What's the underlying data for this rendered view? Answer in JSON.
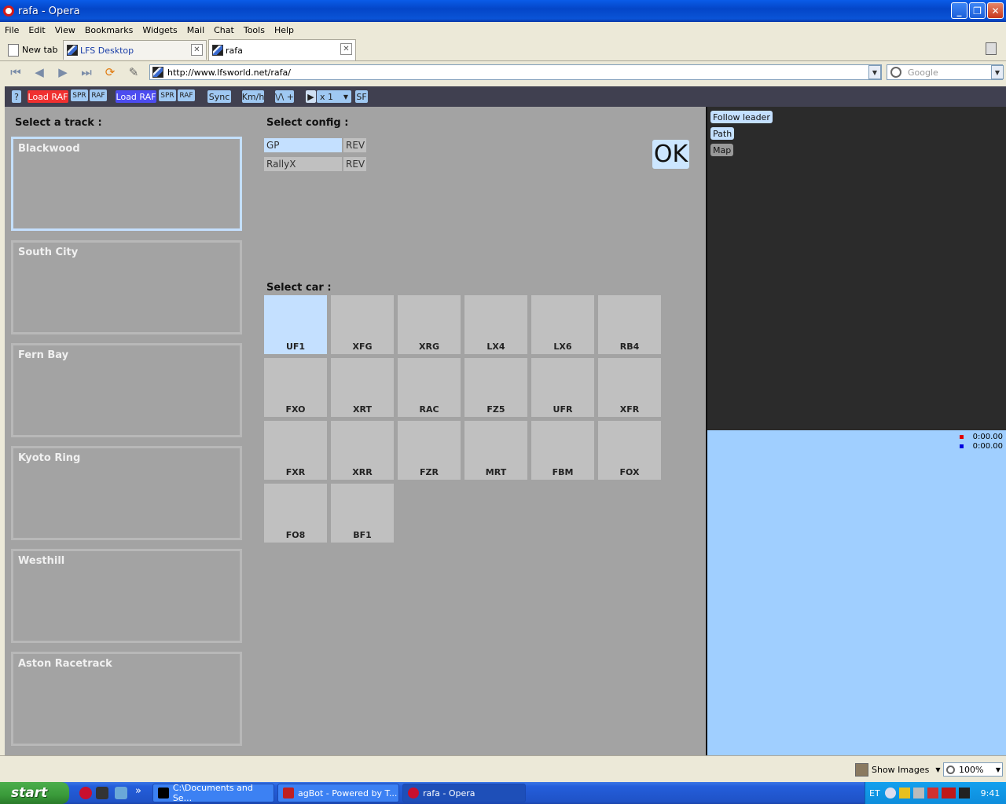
{
  "window": {
    "title": "rafa - Opera"
  },
  "menu": [
    "File",
    "Edit",
    "View",
    "Bookmarks",
    "Widgets",
    "Mail",
    "Chat",
    "Tools",
    "Help"
  ],
  "tabs": {
    "new_tab": "New tab",
    "tab1": "LFS Desktop",
    "tab2": "rafa"
  },
  "address": {
    "url": "http://www.lfsworld.net/rafa/",
    "search_placeholder": "Google"
  },
  "toolbar": {
    "help": "?",
    "load_raf_1": "Load RAF",
    "spr_1": "SPR",
    "raf_1": "RAF",
    "load_raf_2": "Load RAF",
    "spr_2": "SPR",
    "raf_2": "RAF",
    "sync": "Sync",
    "kmh": "Km/h",
    "vplus": "\\/\\ +",
    "speed": "x 1",
    "sf": "SF"
  },
  "labels": {
    "select_track": "Select a track :",
    "select_config": "Select config :",
    "select_car": "Select car :",
    "ok": "OK"
  },
  "tracks": [
    "Blackwood",
    "South City",
    "Fern Bay",
    "Kyoto Ring",
    "Westhill",
    "Aston Racetrack"
  ],
  "configs": [
    {
      "name": "GP",
      "rev": "REV"
    },
    {
      "name": "RallyX",
      "rev": "REV"
    }
  ],
  "cars": [
    "UF1",
    "XFG",
    "XRG",
    "LX4",
    "LX6",
    "RB4",
    "FXO",
    "XRT",
    "RAC",
    "FZ5",
    "UFR",
    "XFR",
    "FXR",
    "XRR",
    "FZR",
    "MRT",
    "FBM",
    "FOX",
    "FO8",
    "BF1"
  ],
  "map_panel": {
    "follow_leader": "Follow leader",
    "path": "Path",
    "map": "Map"
  },
  "times": [
    "0:00.00",
    "0:00.00"
  ],
  "status": {
    "show_images": "Show Images",
    "zoom": "100%"
  },
  "taskbar": {
    "start": "start",
    "tasks": [
      "C:\\Documents and Se...",
      "agBot - Powered by T...",
      "rafa - Opera"
    ],
    "lang": "ET",
    "clock": "9:41"
  },
  "colors": {
    "selected": "#c4e0ff",
    "load_raf_red": "#f03030",
    "load_raf_blue": "#4c4cf0",
    "page_bg": "#a3a3a3"
  }
}
